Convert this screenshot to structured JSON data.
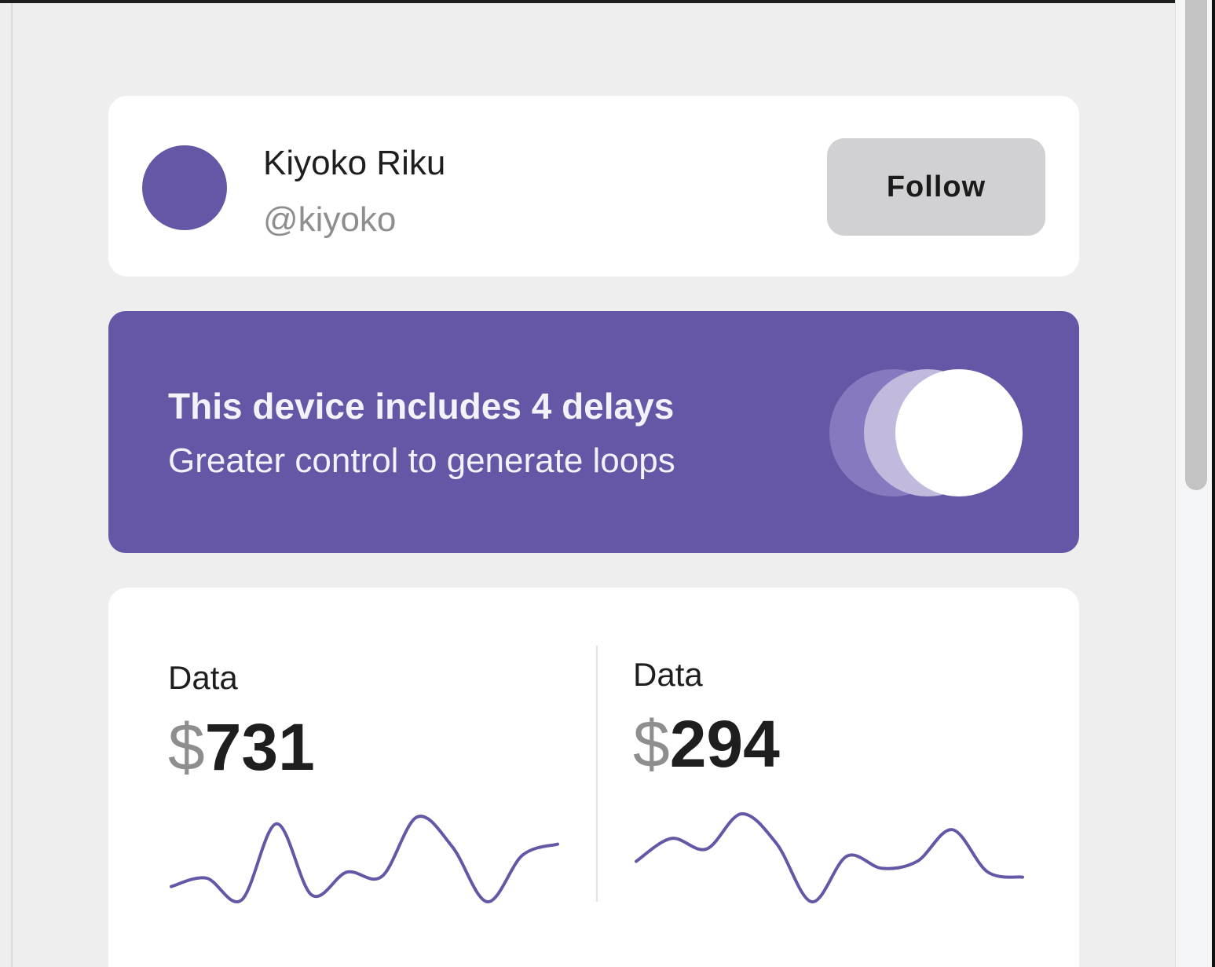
{
  "profile": {
    "name": "Kiyoko Riku",
    "handle": "@kiyoko",
    "follow_label": "Follow",
    "avatar_color": "#6557a6"
  },
  "promo": {
    "title": "This device includes 4 delays",
    "subtitle": "Greater control to generate loops",
    "background_color": "#6557a6",
    "toggle_on": true
  },
  "stats": [
    {
      "label": "Data",
      "currency": "$",
      "amount": "731",
      "sparkline": [
        0.18,
        0.28,
        0.02,
        0.92,
        0.08,
        0.35,
        0.3,
        1.0,
        0.65,
        0.0,
        0.55,
        0.68
      ]
    },
    {
      "label": "Data",
      "currency": "$",
      "amount": "294",
      "sparkline": [
        0.46,
        0.72,
        0.6,
        1.0,
        0.66,
        0.0,
        0.52,
        0.38,
        0.46,
        0.82,
        0.34,
        0.28
      ]
    }
  ],
  "colors": {
    "accent": "#6557a6",
    "page_background": "#eeeeee",
    "card_background": "#ffffff",
    "button_background": "#d1d1d4",
    "muted_text": "#8e8e8e"
  }
}
